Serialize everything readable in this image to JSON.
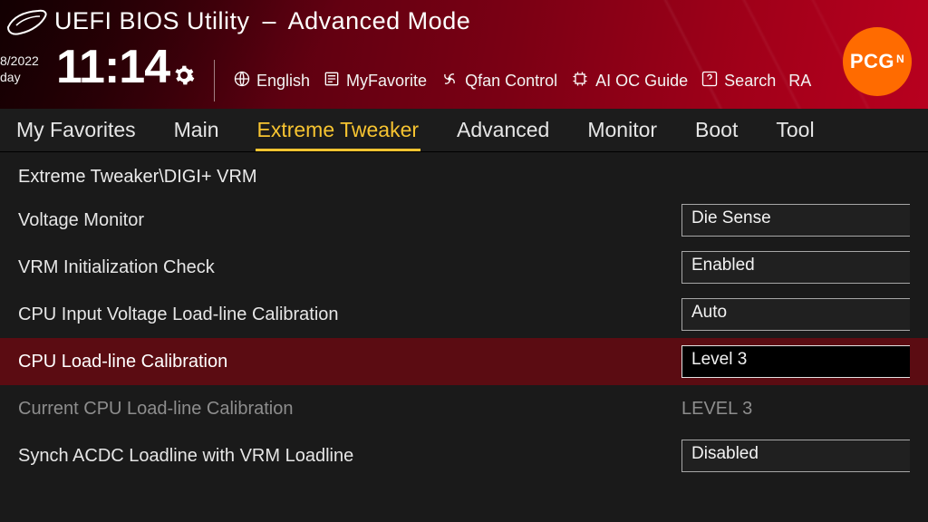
{
  "header": {
    "title_left": "UEFI BIOS Utility",
    "title_right": "Advanced Mode",
    "date": "8/2022",
    "day": "day",
    "time": "11:14"
  },
  "toolbar": {
    "language": "English",
    "myfavorite": "MyFavorite",
    "qfan": "Qfan Control",
    "aioc": "AI OC Guide",
    "search": "Search",
    "aura": "RA"
  },
  "badge": {
    "text": "PCG",
    "sup": "N"
  },
  "tabs": [
    "My Favorites",
    "Main",
    "Extreme Tweaker",
    "Advanced",
    "Monitor",
    "Boot",
    "Tool"
  ],
  "active_tab": "Extreme Tweaker",
  "breadcrumb": "Extreme Tweaker\\DIGI+ VRM",
  "settings": [
    {
      "label": "Voltage Monitor",
      "value": "Die Sense",
      "type": "select"
    },
    {
      "label": "VRM Initialization Check",
      "value": "Enabled",
      "type": "select"
    },
    {
      "label": "CPU Input Voltage Load-line Calibration",
      "value": "Auto",
      "type": "select"
    },
    {
      "label": "CPU Load-line Calibration",
      "value": "Level 3",
      "type": "select",
      "highlight": true
    },
    {
      "label": "Current CPU Load-line Calibration",
      "value": "LEVEL 3",
      "type": "readonly"
    },
    {
      "label": "Synch ACDC Loadline with VRM Loadline",
      "value": "Disabled",
      "type": "select"
    }
  ]
}
